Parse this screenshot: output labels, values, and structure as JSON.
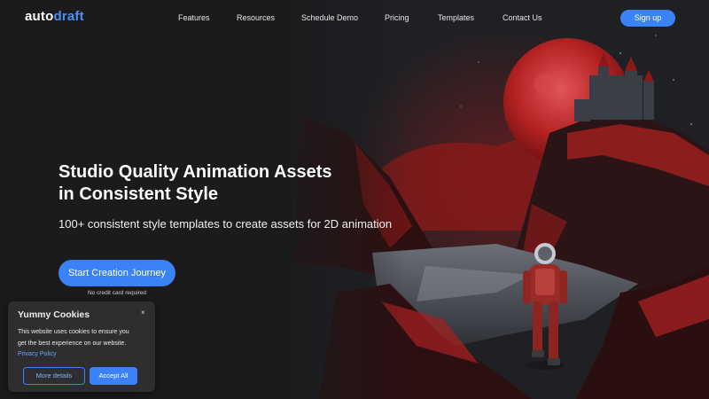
{
  "brand": {
    "logo_part1": "auto",
    "logo_part2": "draft"
  },
  "nav": {
    "links": [
      "Features",
      "Resources",
      "Schedule Demo",
      "Pricing",
      "Templates",
      "Contact Us"
    ],
    "signup_label": "Sign up"
  },
  "hero": {
    "headline_line1": "Studio Quality Animation Assets",
    "headline_line2": "in Consistent Style",
    "subheadline": "100+ consistent style templates to create assets for 2D animation",
    "cta_label": "Start Creation Journey",
    "cta_note": "No credit card required",
    "image_icon": "astronaut-castle-moon-artwork"
  },
  "cookie_banner": {
    "title": "Yummy Cookies",
    "close_glyph": "×",
    "body": "This website uses cookies to ensure you get the best experience on our website.",
    "privacy_link": "Privacy Policy",
    "more_details_label": "More details",
    "accept_label": "Accept All"
  },
  "colors": {
    "background": "#1b1b1d",
    "accent": "#3b82f6",
    "logo_accent": "#4d8ff5",
    "moon": "#c32a2a"
  }
}
